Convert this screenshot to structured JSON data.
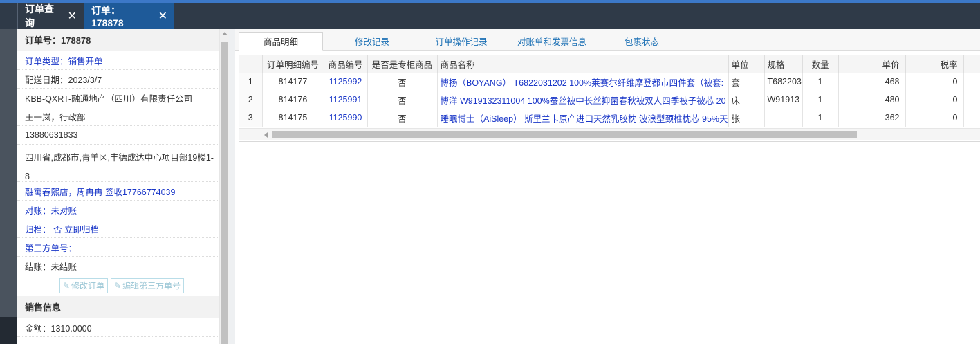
{
  "tabs": [
    {
      "label": "订单查询",
      "close": "✕"
    },
    {
      "label": "订单：178878",
      "close": "✕"
    }
  ],
  "order_panel": {
    "header": "订单号：178878",
    "rows": [
      "订单类型：销售开单",
      "配送日期：2023/3/7",
      "KBB-QXRT-融通地产（四川）有限责任公司",
      "王一岚，行政部",
      "13880631833",
      "四川省,成都市,青羊区,丰德成达中心项目部19楼1-8",
      "融寓春熙店，周冉冉 签收17766774039",
      "对账：未对账",
      "归档： 否 立即归档",
      "第三方单号：",
      "结账：未结账"
    ],
    "buttons": [
      "修改订单",
      "编辑第三方单号"
    ],
    "section_title": "销售信息",
    "amount": "金额：1310.0000"
  },
  "detail_tabs": [
    "商品明细",
    "修改记录",
    "订单操作记录",
    "对账单和发票信息",
    "包裹状态"
  ],
  "table": {
    "columns": [
      "",
      "订单明细编号",
      "商品编号",
      "是否是专柜商品",
      "商品名称",
      "单位",
      "规格",
      "数量",
      "单价",
      "税率"
    ],
    "rows": [
      [
        "1",
        "814177",
        "1125992",
        "否",
        "博扬（BOYANG） T6822031202 100%莱赛尔纤维摩登都市四件套（被套:",
        "套",
        "T682203",
        "1",
        "468",
        "0"
      ],
      [
        "2",
        "814176",
        "1125991",
        "否",
        "博洋 W919132311004 100%蚕丝被中长丝抑菌春秋被双人四季被子被芯 20",
        "床",
        "W91913",
        "1",
        "480",
        "0"
      ],
      [
        "3",
        "814175",
        "1125990",
        "否",
        "睡眠博士（AiSleep） 斯里兰卡原产进口天然乳胶枕 波浪型颈椎枕芯 95%天",
        "张",
        "",
        "1",
        "362",
        "0"
      ]
    ]
  },
  "colors": {
    "topbar": "#2f3a48",
    "accent": "#3c78c8",
    "active_tab": "#1e5a99",
    "link": "#1a37c8"
  },
  "icons": [
    "close-icon",
    "edit-icon",
    "scroll-up-icon",
    "scroll-left-icon"
  ]
}
